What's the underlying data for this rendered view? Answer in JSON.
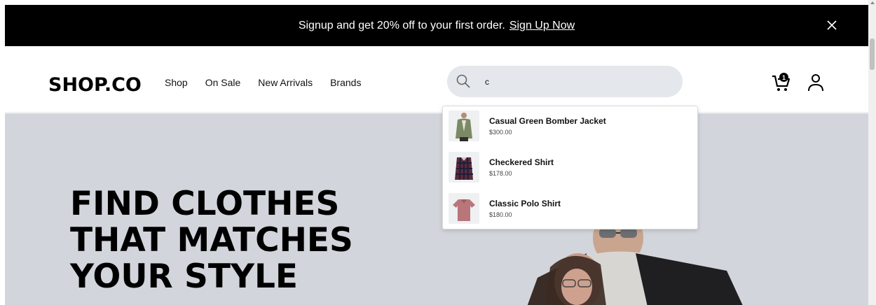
{
  "promo": {
    "text": "Signup and get 20% off to your first order.",
    "link": "Sign Up Now",
    "close_icon": "close-icon"
  },
  "header": {
    "logo": "SHOP.CO",
    "nav": [
      "Shop",
      "On Sale",
      "New Arrivals",
      "Brands"
    ],
    "search": {
      "value": "c",
      "icon": "search-icon"
    },
    "cart": {
      "count": "1",
      "icon": "cart-icon"
    },
    "account_icon": "user-icon"
  },
  "suggestions": [
    {
      "name": "Casual Green Bomber Jacket",
      "price": "$300.00"
    },
    {
      "name": "Checkered Shirt",
      "price": "$178.00"
    },
    {
      "name": "Classic Polo Shirt",
      "price": "$180.00"
    }
  ],
  "hero": {
    "title_lines": [
      "FIND CLOTHES",
      "THAT MATCHES",
      "YOUR STYLE"
    ]
  },
  "colors": {
    "promo_bg": "#000000",
    "search_bg": "#e4e7eb",
    "hero_bg": "#d2d5db"
  }
}
